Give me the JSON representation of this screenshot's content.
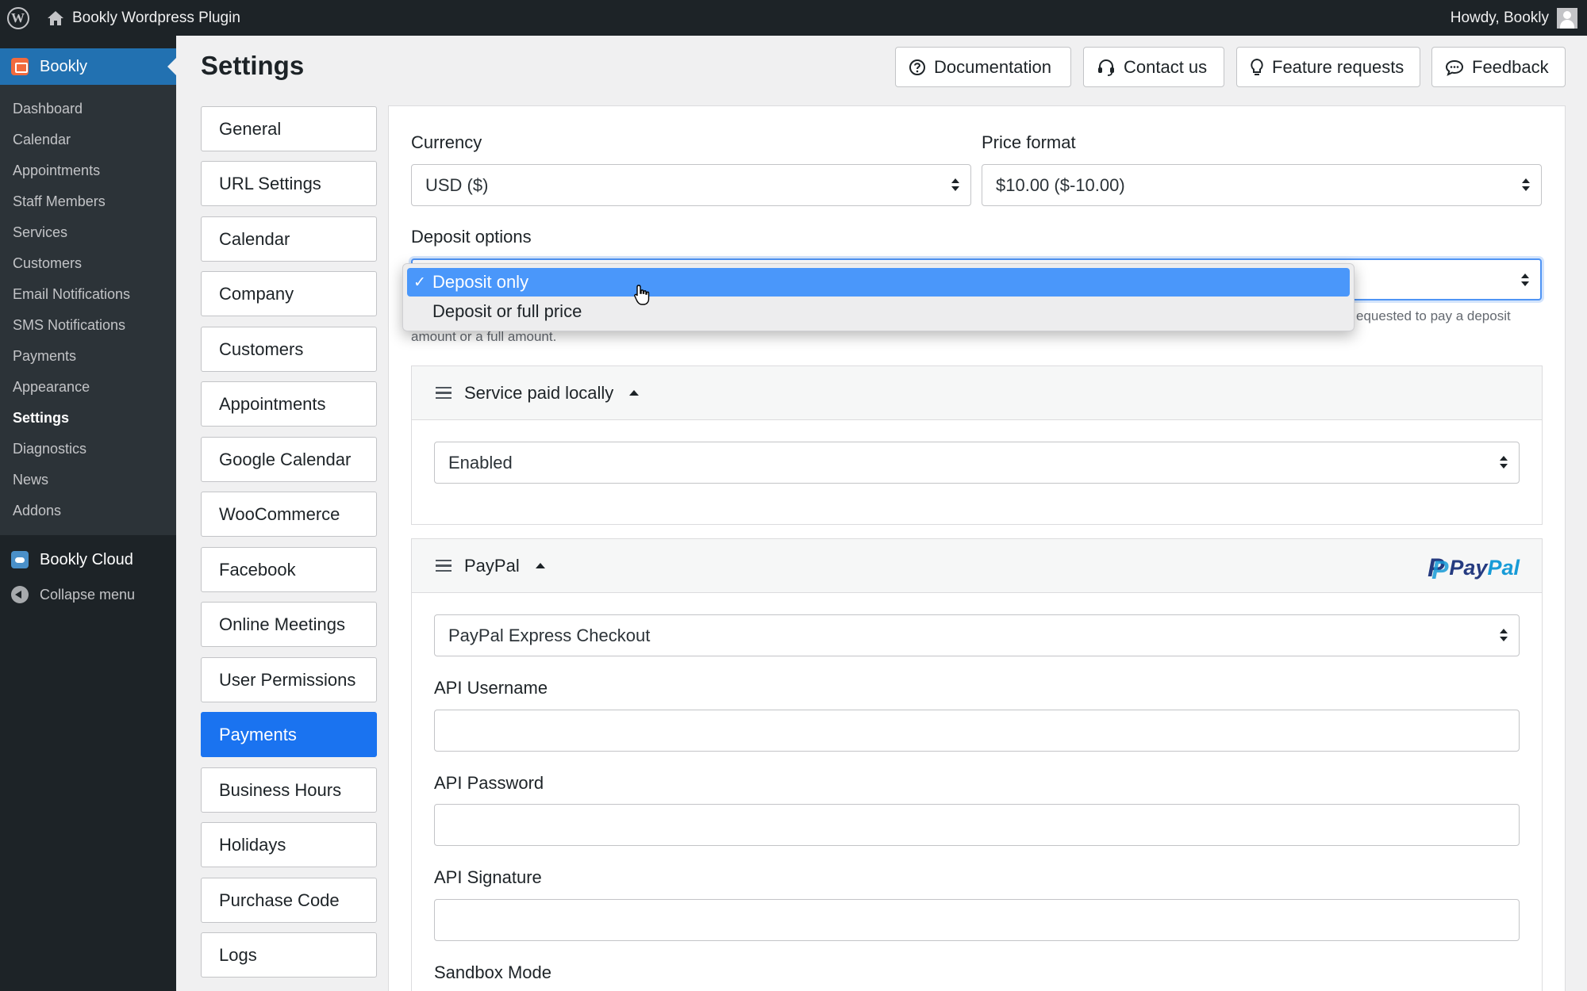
{
  "adminbar": {
    "site_name": "Bookly Wordpress Plugin",
    "howdy": "Howdy, Bookly"
  },
  "sidebar": {
    "plugin_title": "Bookly",
    "items": [
      "Dashboard",
      "Calendar",
      "Appointments",
      "Staff Members",
      "Services",
      "Customers",
      "Email Notifications",
      "SMS Notifications",
      "Payments",
      "Appearance",
      "Settings",
      "Diagnostics",
      "News",
      "Addons"
    ],
    "current": "Settings",
    "cloud": "Bookly Cloud",
    "collapse": "Collapse menu"
  },
  "header": {
    "title": "Settings",
    "buttons": {
      "documentation": "Documentation",
      "contact": "Contact us",
      "features": "Feature requests",
      "feedback": "Feedback"
    }
  },
  "settings_nav": [
    "General",
    "URL Settings",
    "Calendar",
    "Company",
    "Customers",
    "Appointments",
    "Google Calendar",
    "WooCommerce",
    "Facebook",
    "Online Meetings",
    "User Permissions",
    "Payments",
    "Business Hours",
    "Holidays",
    "Purchase Code",
    "Logs"
  ],
  "settings_nav_active": "Payments",
  "form": {
    "currency_label": "Currency",
    "currency_value": "USD ($)",
    "price_format_label": "Price format",
    "price_format_value": "$10.00 ($-10.00)",
    "deposit_label": "Deposit options",
    "deposit_options": [
      "Deposit only",
      "Deposit or full price"
    ],
    "deposit_selected": "Deposit only",
    "deposit_help_right": "equested to pay a deposit",
    "deposit_help_bottom": "amount or a full amount.",
    "service_local": {
      "title": "Service paid locally",
      "value": "Enabled"
    },
    "paypal": {
      "title": "PayPal",
      "logo_a": "Pay",
      "logo_b": "Pal",
      "method": "PayPal Express Checkout",
      "api_username_label": "API Username",
      "api_username_value": "",
      "api_password_label": "API Password",
      "api_password_value": "",
      "api_signature_label": "API Signature",
      "api_signature_value": "",
      "sandbox_label": "Sandbox Mode"
    }
  },
  "colors": {
    "admin_bg": "#1d2327",
    "accent": "#2271b1",
    "active_tab": "#1a73f0",
    "dropdown_highlight": "#4a97fa"
  }
}
